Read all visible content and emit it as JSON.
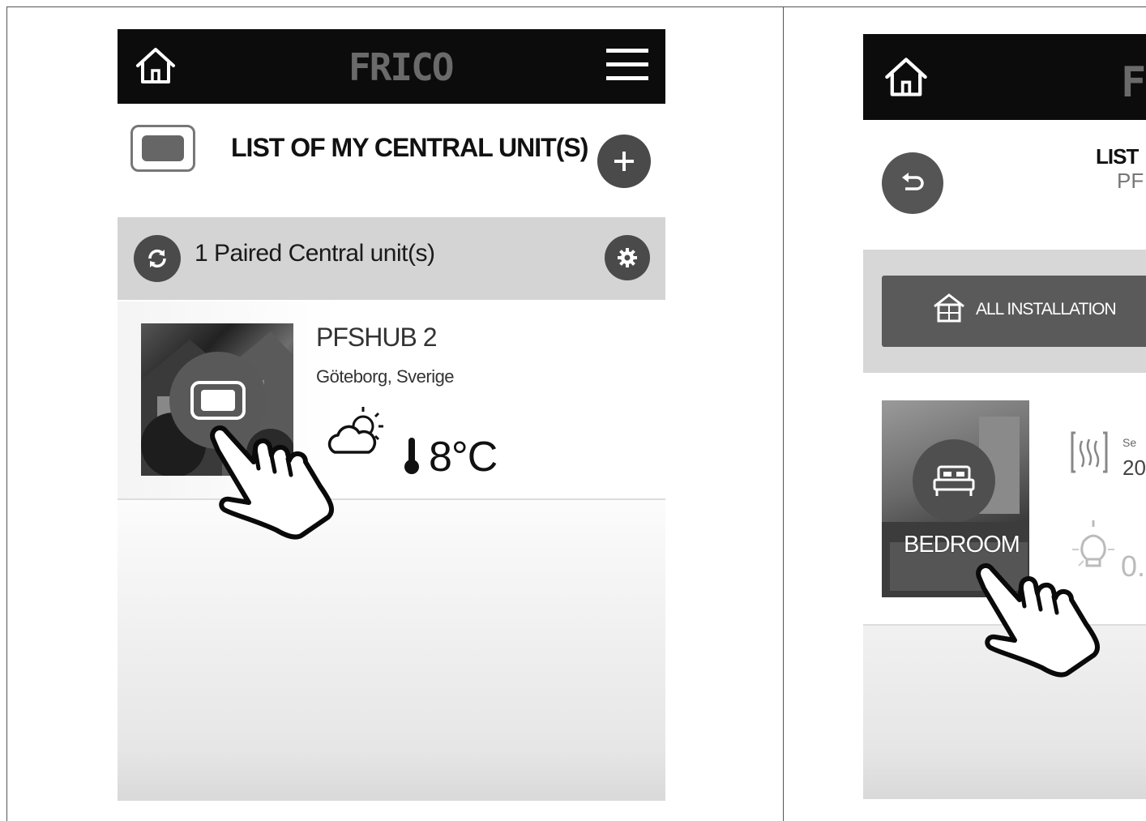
{
  "left": {
    "header": {
      "logo": "FRICO"
    },
    "page_title": "LIST OF MY CENTRAL UNIT(S)",
    "paired_label": "1 Paired Central unit(s)",
    "unit": {
      "name": "PFSHUB 2",
      "location": "Göteborg, Sverige",
      "temperature": "8°C"
    }
  },
  "right": {
    "header": {
      "logo": "F"
    },
    "title_partial": "LIST",
    "subtitle_partial": "PF",
    "all_installation_label": "ALL INSTALLATION",
    "room": {
      "name": "BEDROOM",
      "setpoint_label_partial": "Se",
      "setpoint_value_partial": "20",
      "power_value_partial": "0."
    }
  }
}
